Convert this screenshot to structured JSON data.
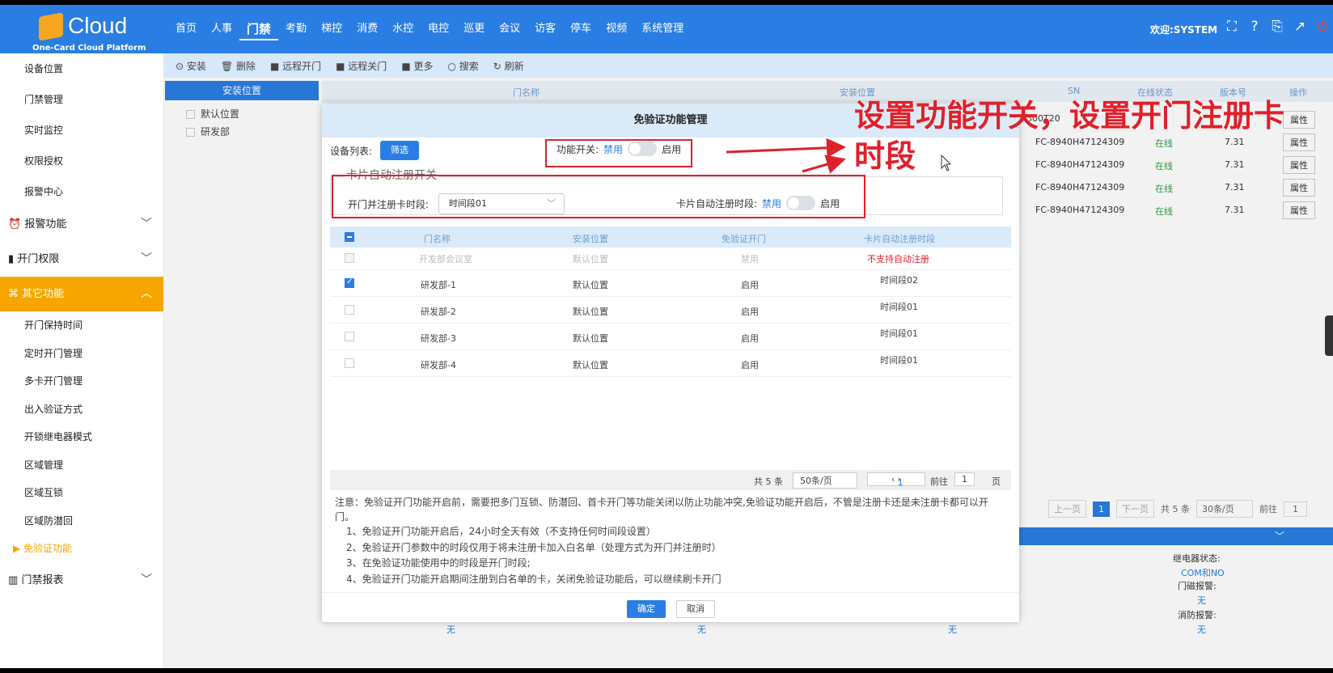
{
  "header": {
    "logo_text": "Cloud",
    "logo_sub": "One-Card Cloud Platform",
    "nav": [
      "首页",
      "人事",
      "门禁",
      "考勤",
      "梯控",
      "消费",
      "水控",
      "电控",
      "巡更",
      "会议",
      "访客",
      "停车",
      "视频",
      "系统管理"
    ],
    "welcome": "欢迎:SYSTEM",
    "icons": [
      "fullscreen-icon",
      "help-icon",
      "language-icon",
      "external-icon",
      "power-icon"
    ]
  },
  "sidebar": {
    "items": [
      "设备位置",
      "门禁管理",
      "实时监控",
      "权限授权",
      "报警中心"
    ],
    "groups": [
      "报警功能",
      "开门权限",
      "其它功能"
    ],
    "subitems": [
      "开门保持时间",
      "定时开门管理",
      "多卡开门管理",
      "出入验证方式",
      "开锁继电器模式",
      "区域管理",
      "区域互锁",
      "区域防潜回"
    ],
    "current": "免验证功能",
    "report": "门禁报表"
  },
  "toolbar": [
    "安装",
    "删除",
    "远程开门",
    "远程关门",
    "更多",
    "搜索",
    "刷新"
  ],
  "locations": {
    "title": "安装位置",
    "items": [
      "默认位置",
      "研发部"
    ]
  },
  "bg_table": {
    "headers": [
      "门名称",
      "安装位置",
      "SN",
      "在线状态",
      "版本号",
      "操作"
    ],
    "sn_partial": "8300T20",
    "rows": [
      {
        "sn": "FC-8940H47124309",
        "status": "在线",
        "ver": "7.31",
        "op": "属性"
      },
      {
        "sn": "FC-8940H47124309",
        "status": "在线",
        "ver": "7.31",
        "op": "属性"
      },
      {
        "sn": "FC-8940H47124309",
        "status": "在线",
        "ver": "7.31",
        "op": "属性"
      },
      {
        "sn": "FC-8940H47124309",
        "status": "在线",
        "ver": "7.31",
        "op": "属性"
      },
      {
        "sn": "FC-8940H47124309",
        "status": "在线",
        "ver": "7.31",
        "op": "属性"
      }
    ],
    "pager": {
      "prev": "上一页",
      "page": "1",
      "next": "下一页",
      "total": "共 5 条",
      "size": "30条/页",
      "goto": "前往",
      "goto_val": "1"
    },
    "info": {
      "relay_label": "继电器状态:",
      "relay_val": "COM和NO",
      "door_alarm": "门磁报警:",
      "door_val": "无",
      "fire_alarm": "消防报警:",
      "fire_val": "无"
    },
    "none": "无"
  },
  "dialog": {
    "title": "免验证功能管理",
    "device_list": "设备列表:",
    "filter": "筛选",
    "fn_switch_label": "功能开关:",
    "disable": "禁用",
    "enable": "启用",
    "auto_reg_title": "卡片自动注册开关",
    "open_reg_label": "开门并注册卡时段:",
    "period_value": "时间段01",
    "auto_reg_label": "卡片自动注册时段:",
    "table_headers": [
      "门名称",
      "安装位置",
      "免验证开门",
      "卡片自动注册时段"
    ],
    "rows": [
      {
        "name": "开发部会议室",
        "loc": "默认位置",
        "free": "禁用",
        "period": "不支持自动注册",
        "checked": false,
        "disabled": true
      },
      {
        "name": "研发部-1",
        "loc": "默认位置",
        "free": "启用",
        "period": "时间段02",
        "checked": true,
        "disabled": false
      },
      {
        "name": "研发部-2",
        "loc": "默认位置",
        "free": "启用",
        "period": "时间段01",
        "checked": false,
        "disabled": false
      },
      {
        "name": "研发部-3",
        "loc": "默认位置",
        "free": "启用",
        "period": "时间段01",
        "checked": false,
        "disabled": false
      },
      {
        "name": "研发部-4",
        "loc": "默认位置",
        "free": "启用",
        "period": "时间段01",
        "checked": false,
        "disabled": false
      }
    ],
    "pager": {
      "total": "共 5 条",
      "size": "50条/页",
      "page": "1",
      "goto": "前往",
      "goto_val": "1",
      "page_unit": "页"
    },
    "notes": {
      "main": "注意：免验证开门功能开启前，需要把多门互锁、防潜回、首卡开门等功能关闭以防止功能冲突,免验证功能开启后，不管是注册卡还是未注册卡都可以开门。",
      "items": [
        "1、免验证开门功能开启后，24小时全天有效（不支持任何时间段设置）",
        "2、免验证开门参数中的时段仅用于将未注册卡加入白名单（处理方式为开门并注册时）",
        "3、在免验证功能使用中的时段是开门时段;",
        "4、免验证开门功能开启期间注册到白名单的卡，关闭免验证功能后，可以继续刷卡开门"
      ]
    },
    "ok": "确定",
    "cancel": "取消"
  },
  "annotation": {
    "line1": "设置功能开关，设置开门注册卡",
    "line2": "时段",
    "color": "#e0202a"
  }
}
